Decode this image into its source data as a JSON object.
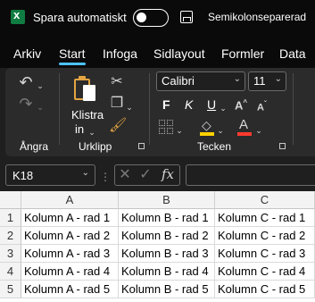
{
  "titlebar": {
    "autosave_label": "Spara automatiskt",
    "autosave_state": "off",
    "doc_title": "Semikolonseparerad"
  },
  "tabs": [
    {
      "label": "Arkiv"
    },
    {
      "label": "Start",
      "active": true
    },
    {
      "label": "Infoga"
    },
    {
      "label": "Sidlayout"
    },
    {
      "label": "Formler"
    },
    {
      "label": "Data"
    }
  ],
  "ribbon": {
    "undo_group_label": "Ångra",
    "clipboard": {
      "paste_label": "Klistra",
      "paste_sub": "in",
      "group_label": "Urklipp"
    },
    "font": {
      "name": "Calibri",
      "size": "11",
      "group_label": "Tecken",
      "bold": "F",
      "italic": "K",
      "underline": "U"
    }
  },
  "formula_bar": {
    "name_box": "K18",
    "fx": "fx",
    "formula": ""
  },
  "sheet": {
    "columns": [
      "A",
      "B",
      "C"
    ],
    "rows": [
      {
        "num": "1",
        "cells": [
          "Kolumn A - rad 1",
          "Kolumn B - rad 1",
          "Kolumn C - rad 1"
        ]
      },
      {
        "num": "2",
        "cells": [
          "Kolumn A - rad 2",
          "Kolumn B - rad 2",
          "Kolumn C - rad 2"
        ]
      },
      {
        "num": "3",
        "cells": [
          "Kolumn A - rad 3",
          "Kolumn B - rad 3",
          "Kolumn C - rad 3"
        ]
      },
      {
        "num": "4",
        "cells": [
          "Kolumn A - rad 4",
          "Kolumn B - rad 4",
          "Kolumn C - rad 4"
        ]
      },
      {
        "num": "5",
        "cells": [
          "Kolumn A - rad 5",
          "Kolumn B - rad 5",
          "Kolumn C - rad 5"
        ]
      }
    ]
  },
  "colors": {
    "accent": "#4cc2ff",
    "excel_green": "#107c41",
    "highlight_yellow": "#ffd200",
    "font_red": "#ff3b30"
  }
}
